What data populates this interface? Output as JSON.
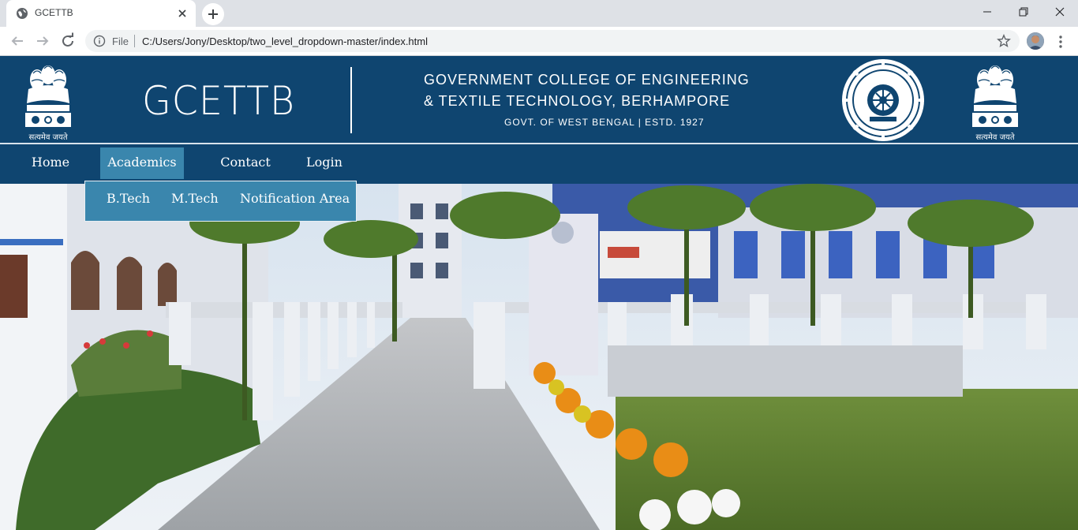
{
  "browser": {
    "tab_title": "GCETTB",
    "url_scheme": "File",
    "url": "C:/Users/Jony/Desktop/two_level_dropdown-master/index.html"
  },
  "header": {
    "brand": "GCETTB",
    "college_line1": "GOVERNMENT COLLEGE OF ENGINEERING",
    "college_line2": "& TEXTILE TECHNOLOGY, BERHAMPORE",
    "college_line3": "GOVT. OF WEST BENGAL | ESTD. 1927",
    "emblem_motto": "सत्यमेव जयते"
  },
  "nav": {
    "items": [
      {
        "label": "Home"
      },
      {
        "label": "Academics"
      },
      {
        "label": "Contact"
      },
      {
        "label": "Login"
      }
    ],
    "active": "Academics"
  },
  "dropdown": {
    "items": [
      {
        "label": "B.Tech"
      },
      {
        "label": "M.Tech"
      },
      {
        "label": "Notification Area"
      }
    ]
  },
  "colors": {
    "header_bg": "#0f4570",
    "nav_active_bg": "#3a86ad",
    "dropdown_bg": "#3a86ad",
    "text": "#ffffff"
  },
  "icons": [
    "globe-icon",
    "close-icon",
    "plus-icon",
    "minimize-icon",
    "restore-icon",
    "back-icon",
    "forward-icon",
    "reload-icon",
    "info-icon",
    "star-icon",
    "avatar",
    "kebab-menu-icon",
    "national-emblem-icon",
    "college-seal-icon"
  ]
}
